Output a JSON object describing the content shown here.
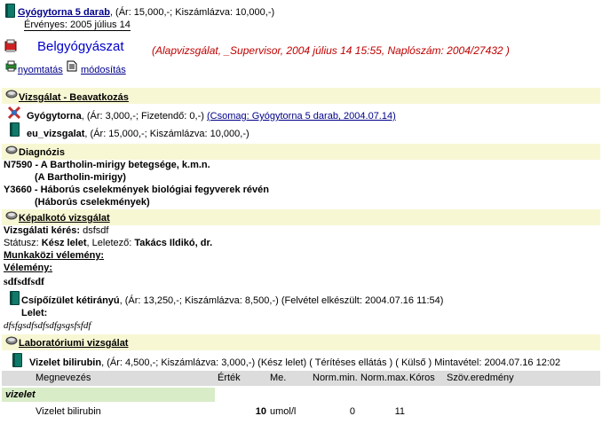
{
  "package": {
    "link": " Gyógytorna 5 darab",
    "price_text": ",  (Ár: 15,000,-; Kiszámlázva: 10,000,-)",
    "validity": "Érvényes: 2005 július 14"
  },
  "header": {
    "title": "Belgyógyászat",
    "subtitle": "(Alapvizsgálat, _Supervisor, 2004 július 14  15:55, Naplószám: 2004/27432 )"
  },
  "toolbar": {
    "print_label": "nyomtatás",
    "edit_label": "módosítás"
  },
  "sections": {
    "exam": {
      "title": "Vizsgálat - Beavatkozás",
      "items": [
        {
          "name": "Gyógytorna",
          "detail": ",  (Ár: 3,000,-;  Fizetendő: 0,-)",
          "link": "(Csomag: Gyógytorna 5 darab, 2004.07.14)"
        },
        {
          "name": "eu_vizsgalat",
          "detail": ",  (Ár: 15,000,-; Kiszámlázva: 10,000,-)"
        }
      ]
    },
    "diagnosis": {
      "title": "Diagnózis",
      "items": [
        {
          "code": "N7590 - A Bartholin-mirigy betegsége, k.m.n.",
          "sub": "(A Bartholin-mirigy)"
        },
        {
          "code": "Y3660 - Háborús cselekmények biológiai fegyverek révén",
          "sub": "(Háborús cselekmények)"
        }
      ]
    },
    "imaging": {
      "title": "Képalkotó vizsgálat",
      "request_label": "Vizsgálati kérés:",
      "request_value": " dsfsdf",
      "status_label": "Státusz: ",
      "status_value": "Kész lelet",
      "reporter_label": ", Leletező: ",
      "reporter_value": "Takács Ildikó, dr.",
      "interim_label": "Munkaközi vélemény: ",
      "opinion_label": "Vélemény:",
      "opinion_value": "sdfsdfsdf",
      "item_name": "Csípőízület kétirányú",
      "item_detail": ",  (Ár: 13,250,-; Kiszámlázva: 8,500,-)  (Felvétel elkészült: 2004.07.16 11:54)",
      "finding_label": "Lelet:",
      "finding_value": "dfsfgsdfsdfsdfgsgsfsfdf"
    },
    "lab": {
      "title": "Laboratóriumi vizsgálat",
      "item_name": "Vizelet bilirubin",
      "item_detail": ",  (Ár: 4,500,-; Kiszámlázva: 3,000,-) (Kész lelet) ( Térítéses ellátás ) ( Külső ) Mintavétel: 2004.07.16 12:02",
      "columns": [
        "Megnevezés",
        "Érték",
        "Me.",
        "Norm.min.",
        "Norm.max.",
        "Kóros",
        "Szöv.eredmény"
      ],
      "group": "vizelet",
      "rows": [
        {
          "name": "Vizelet bilirubin",
          "value": "10",
          "unit": "umol/l",
          "min": "0",
          "max": "11",
          "abnormal": "",
          "text": ""
        }
      ]
    }
  },
  "colors": {
    "section_bg": "#f7f7d4",
    "table_header_bg": "#dcdcdc",
    "group_bg": "#d8ecc8",
    "title_blue": "#0000cc",
    "subtitle_red": "#c00000",
    "link_blue": "#00008b"
  }
}
